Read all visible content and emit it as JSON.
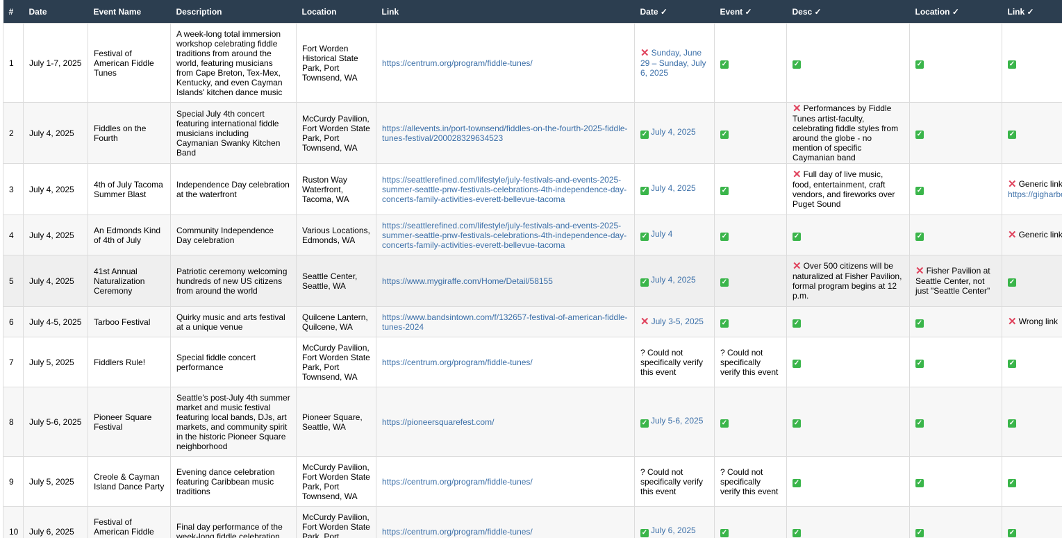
{
  "headers": [
    "#",
    "Date",
    "Event Name",
    "Description",
    "Location",
    "Link",
    "Date ✓",
    "Event ✓",
    "Desc ✓",
    "Location ✓",
    "Link ✓"
  ],
  "rows": [
    {
      "num": "1",
      "date": "July 1-7, 2025",
      "event": "Festival of American Fiddle Tunes",
      "desc": "A week-long total immersion workshop celebrating fiddle traditions from around the world, featuring musicians from Cape Breton, Tex-Mex, Kentucky, and even Cayman Islands' kitchen dance music",
      "location": "Fort Worden Historical State Park, Port Townsend, WA",
      "link": "https://centrum.org/program/fiddle-tunes/",
      "v": [
        {
          "s": "cross",
          "t": "Sunday, June 29 – Sunday, July 6, 2025",
          "blue": true
        },
        {
          "s": "check",
          "t": ""
        },
        {
          "s": "check",
          "t": ""
        },
        {
          "s": "check",
          "t": ""
        },
        {
          "s": "check",
          "t": ""
        }
      ]
    },
    {
      "num": "2",
      "date": "July 4, 2025",
      "event": "Fiddles on the Fourth",
      "desc": "Special July 4th concert featuring international fiddle musicians including Caymanian Swanky Kitchen Band",
      "location": "McCurdy Pavilion, Fort Worden State Park, Port Townsend, WA",
      "link": "https://allevents.in/port-townsend/fiddles-on-the-fourth-2025-fiddle-tunes-festival/200028329634523",
      "v": [
        {
          "s": "check",
          "t": "July 4, 2025",
          "blue": true
        },
        {
          "s": "check",
          "t": ""
        },
        {
          "s": "cross",
          "t": "Performances by Fiddle Tunes artist-faculty, celebrating fiddle styles from around the globe - no mention of specific Caymanian band"
        },
        {
          "s": "check",
          "t": ""
        },
        {
          "s": "check",
          "t": ""
        }
      ]
    },
    {
      "num": "3",
      "date": "July 4, 2025",
      "event": "4th of July Tacoma Summer Blast",
      "desc": "Independence Day celebration at the waterfront",
      "location": "Ruston Way Waterfront, Tacoma, WA",
      "link": "https://seattlerefined.com/lifestyle/july-festivals-and-events-2025-summer-seattle-pnw-festivals-celebrations-4th-independence-day-concerts-family-activities-everett-bellevue-tacoma",
      "v": [
        {
          "s": "check",
          "t": "July 4, 2025",
          "blue": true
        },
        {
          "s": "check",
          "t": ""
        },
        {
          "s": "cross",
          "t": "Full day of live music, food, entertainment, craft vendors, and fireworks over Puget Sound"
        },
        {
          "s": "check",
          "t": ""
        },
        {
          "s": "cross",
          "t": "Generic link",
          "t2": "https://gigharbo"
        }
      ]
    },
    {
      "num": "4",
      "date": "July 4, 2025",
      "event": "An Edmonds Kind of 4th of July",
      "desc": "Community Independence Day celebration",
      "location": "Various Locations, Edmonds, WA",
      "link": "https://seattlerefined.com/lifestyle/july-festivals-and-events-2025-summer-seattle-pnw-festivals-celebrations-4th-independence-day-concerts-family-activities-everett-bellevue-tacoma",
      "v": [
        {
          "s": "check",
          "t": "July 4",
          "blue": true
        },
        {
          "s": "check",
          "t": ""
        },
        {
          "s": "check",
          "t": ""
        },
        {
          "s": "check",
          "t": ""
        },
        {
          "s": "cross",
          "t": "Generic link"
        }
      ]
    },
    {
      "num": "5",
      "date": "July 4, 2025",
      "event": "41st Annual Naturalization Ceremony",
      "desc": "Patriotic ceremony welcoming hundreds of new US citizens from around the world",
      "location": "Seattle Center, Seattle, WA",
      "link": "https://www.mygiraffe.com/Home/Detail/58155",
      "v": [
        {
          "s": "check",
          "t": "July 4, 2025",
          "blue": true
        },
        {
          "s": "check",
          "t": ""
        },
        {
          "s": "cross",
          "t": "Over 500 citizens will be naturalized at Fisher Pavilion, formal program begins at 12 p.m."
        },
        {
          "s": "cross",
          "t": "Fisher Pavilion at Seattle Center, not just \"Seattle Center\""
        },
        {
          "s": "check",
          "t": ""
        }
      ]
    },
    {
      "num": "6",
      "date": "July 4-5, 2025",
      "event": "Tarboo Festival",
      "desc": "Quirky music and arts festival at a unique venue",
      "location": "Quilcene Lantern, Quilcene, WA",
      "link": "https://www.bandsintown.com/f/132657-festival-of-american-fiddle-tunes-2024",
      "v": [
        {
          "s": "cross",
          "t": "July 3-5, 2025",
          "blue": true
        },
        {
          "s": "check",
          "t": ""
        },
        {
          "s": "check",
          "t": ""
        },
        {
          "s": "check",
          "t": ""
        },
        {
          "s": "cross",
          "t": "Wrong link"
        }
      ]
    },
    {
      "num": "7",
      "date": "July 5, 2025",
      "event": "Fiddlers Rule!",
      "desc": "Special fiddle concert performance",
      "location": "McCurdy Pavilion, Fort Worden State Park, Port Townsend, WA",
      "link": "https://centrum.org/program/fiddle-tunes/",
      "v": [
        {
          "s": "q",
          "t": "? Could not specifically verify this event"
        },
        {
          "s": "q",
          "t": "? Could not specifically verify this event"
        },
        {
          "s": "check",
          "t": ""
        },
        {
          "s": "check",
          "t": ""
        },
        {
          "s": "check",
          "t": ""
        }
      ]
    },
    {
      "num": "8",
      "date": "July 5-6, 2025",
      "event": "Pioneer Square Festival",
      "desc": "Seattle's post-July 4th summer market and music festival featuring local bands, DJs, art markets, and community spirit in the historic Pioneer Square neighborhood",
      "location": "Pioneer Square, Seattle, WA",
      "link": "https://pioneersquarefest.com/",
      "v": [
        {
          "s": "check",
          "t": "July 5-6, 2025",
          "blue": true
        },
        {
          "s": "check",
          "t": ""
        },
        {
          "s": "check",
          "t": ""
        },
        {
          "s": "check",
          "t": ""
        },
        {
          "s": "check",
          "t": ""
        }
      ]
    },
    {
      "num": "9",
      "date": "July 5, 2025",
      "event": "Creole & Cayman Island Dance Party",
      "desc": "Evening dance celebration featuring Caribbean music traditions",
      "location": "McCurdy Pavilion, Fort Worden State Park, Port Townsend, WA",
      "link": "https://centrum.org/program/fiddle-tunes/",
      "v": [
        {
          "s": "q",
          "t": "? Could not specifically verify this event"
        },
        {
          "s": "q",
          "t": "? Could not specifically verify this event"
        },
        {
          "s": "check",
          "t": ""
        },
        {
          "s": "check",
          "t": ""
        },
        {
          "s": "check",
          "t": ""
        }
      ]
    },
    {
      "num": "10",
      "date": "July 6, 2025",
      "event": "Festival of American Fiddle Tunes",
      "desc": "Final day performance of the week-long fiddle celebration",
      "location": "McCurdy Pavilion, Fort Worden State Park, Port Townsend, WA",
      "link": "https://centrum.org/program/fiddle-tunes/",
      "v": [
        {
          "s": "check",
          "t": "July 6, 2025",
          "blue": true
        },
        {
          "s": "check",
          "t": ""
        },
        {
          "s": "check",
          "t": ""
        },
        {
          "s": "check",
          "t": ""
        },
        {
          "s": "check",
          "t": ""
        }
      ]
    }
  ]
}
